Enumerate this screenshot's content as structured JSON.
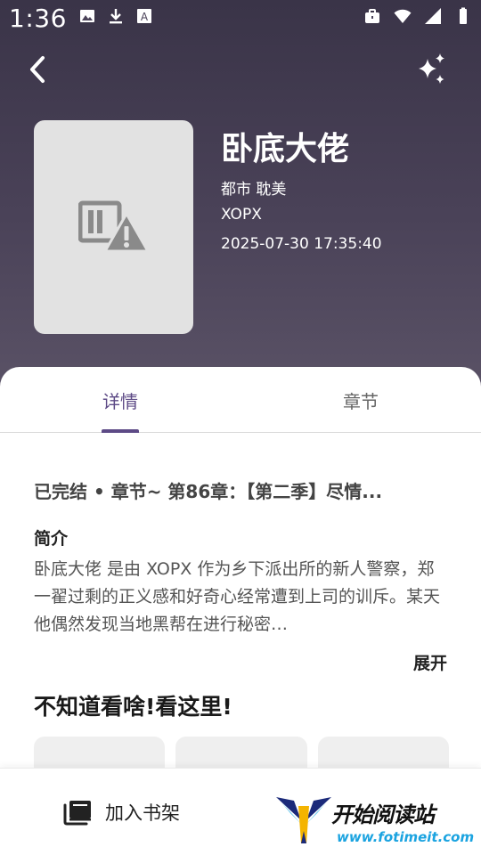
{
  "status_bar": {
    "time": "1:36"
  },
  "book": {
    "title": "卧底大佬",
    "tags": "都市 耽美",
    "author": "XOPX",
    "updated": "2025-07-30 17:35:40",
    "cover_icon": "image-broken-warning-icon"
  },
  "tabs": [
    {
      "label": "详情",
      "active": true
    },
    {
      "label": "章节",
      "active": false
    }
  ],
  "details": {
    "status_line": "已完结 • 章节~ 第86章：【第二季】尽情...",
    "intro_heading": "简介",
    "intro_text": "卧底大佬 是由 XOPX 作为乡下派出所的新人警察，郑一翟过剩的正义感和好奇心经常遭到上司的训斥。某天他偶然发现当地黑帮在进行秘密…",
    "expand_label": "展开"
  },
  "recommend": {
    "heading": "不知道看啥!看这里!"
  },
  "bottom_bar": {
    "add_shelf_label": "加入书架"
  },
  "watermark": {
    "text": "开始阅读站",
    "url": "www.fotimeit.com"
  },
  "colors": {
    "accent": "#5d4a86",
    "hero_bg": "#4a4258"
  }
}
